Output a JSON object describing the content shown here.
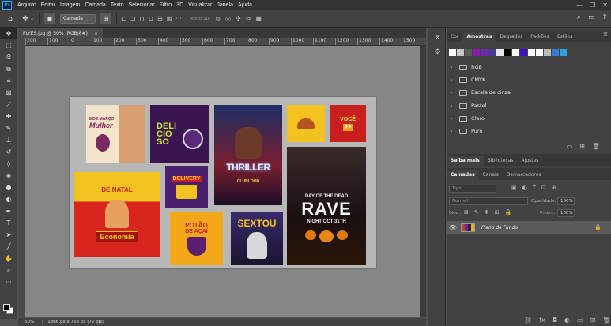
{
  "app": {
    "logo": "Ps"
  },
  "menu": [
    "Arquivo",
    "Editar",
    "Imagem",
    "Camada",
    "Texto",
    "Selecionar",
    "Filtro",
    "3D",
    "Visualizar",
    "Janela",
    "Ajuda"
  ],
  "window_controls": {
    "minimize": "—",
    "restore": "❐",
    "close": "✕"
  },
  "options_bar": {
    "layer_select": "Camada",
    "mode3d": "Modo 3D:"
  },
  "document": {
    "tab_title": "FLYES.jpg @ 50% (RGB/8#)",
    "close": "×"
  },
  "ruler": [
    "200",
    "100",
    "0",
    "100",
    "200",
    "300",
    "400",
    "500",
    "600",
    "700",
    "800",
    "900",
    "1000",
    "1100",
    "1200",
    "1300",
    "1400",
    "1500"
  ],
  "canvas": {
    "posters": [
      {
        "id": "mulher",
        "line1": "8 DE MARÇO",
        "line2": "Mulher"
      },
      {
        "id": "delicioso",
        "line1": "DELI",
        "line2": "CIO",
        "line3": "SO"
      },
      {
        "id": "thriller",
        "line1": "THRILLER",
        "line2": "CLUBLOOD"
      },
      {
        "id": "burger",
        "line1": ""
      },
      {
        "id": "voce",
        "line1": "VOCÊ",
        "line2": "22"
      },
      {
        "id": "rave",
        "line1": "DAY OF THE DEAD",
        "line2": "RAVE",
        "line3": "NIGHT OCT 31TH"
      },
      {
        "id": "economia",
        "line1": "DE NATAL",
        "line2": "Economia"
      },
      {
        "id": "delivery",
        "line1": "DELIVERY"
      },
      {
        "id": "acai",
        "line1": "POTÃO",
        "line2": "DE AÇAÍ"
      },
      {
        "id": "sextou",
        "line1": "SEXTOU"
      }
    ]
  },
  "status": {
    "zoom": "50%",
    "doc_info": "1366 px x 768 px (72 ppi)"
  },
  "top_panel": {
    "tabs": [
      "Cor",
      "Amostras",
      "Degradês",
      "Padrões",
      "Estilos"
    ],
    "active_tab": "Amostras",
    "swatches": [
      "#ffffff",
      "#c8c8c8",
      "#5a5a5a",
      "#8a1ba8",
      "#6a2bb0",
      "#4a3c8c",
      "#e8e8e8",
      "#000000",
      "#ffffff",
      "#3a14c8",
      "#ffffff",
      "#ffffff",
      "#bcbcbc",
      "#2f7fd8",
      "#35a0e0"
    ],
    "groups": [
      "RGB",
      "CMYK",
      "Escala de cinza",
      "Pastel",
      "Claro",
      "Puro"
    ]
  },
  "mid_panel": {
    "tabs": [
      "Saiba mais",
      "Bibliotecas",
      "Ajustes"
    ]
  },
  "layers_panel": {
    "tabs": [
      "Camadas",
      "Canais",
      "Demarcadores"
    ],
    "filter_placeholder": "Tipo",
    "blend_mode": "Normal",
    "opacity_label": "Opacidade:",
    "opacity": "100%",
    "lock_label": "Bloq.:",
    "fill_label": "Preen.:",
    "fill": "100%",
    "layers": [
      {
        "name": "Plano de Fundo",
        "visible": true,
        "locked": true
      }
    ]
  }
}
